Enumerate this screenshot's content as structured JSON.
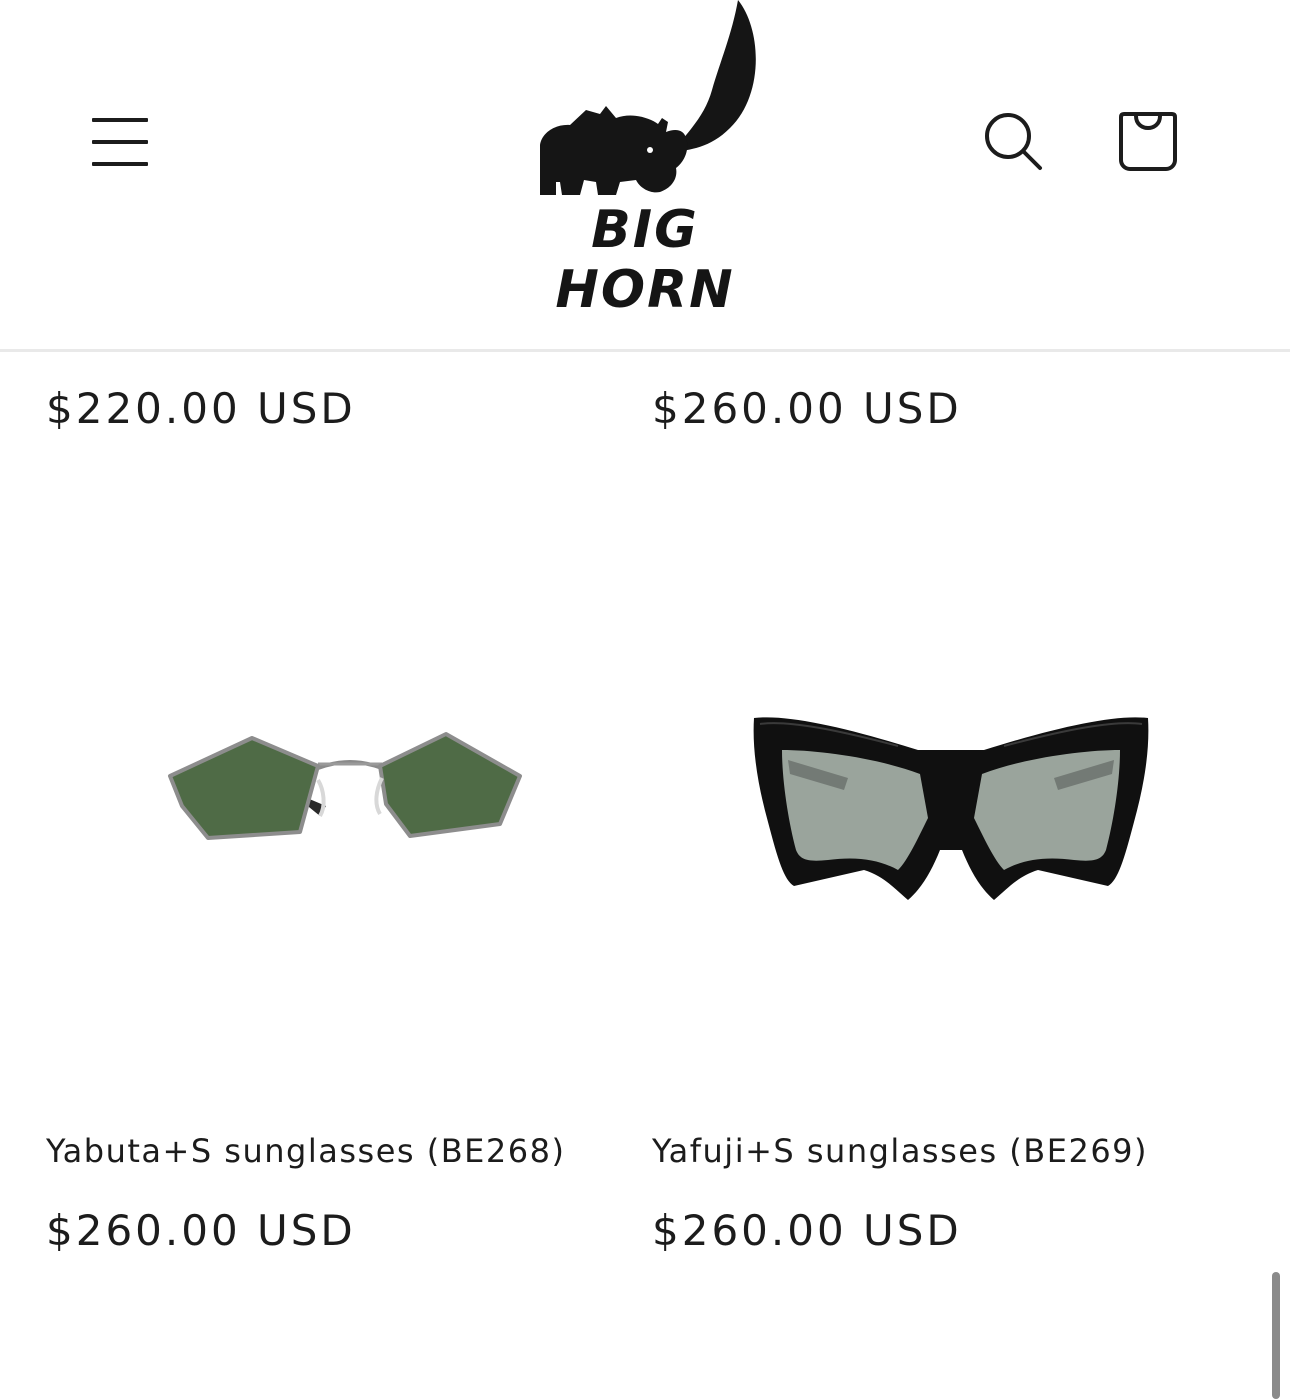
{
  "header": {
    "brand": "BIG HORN",
    "menu_icon": "hamburger-menu-icon",
    "search_icon": "search-icon",
    "cart_icon": "cart-bag-icon"
  },
  "products": [
    {
      "price": "$220.00 USD"
    },
    {
      "price": "$260.00 USD"
    },
    {
      "title": "Yabuta+S sunglasses (BE268)",
      "price": "$260.00 USD"
    },
    {
      "title": "Yafuji+S sunglasses (BE269)",
      "price": "$260.00 USD"
    }
  ],
  "colors": {
    "text": "#1c1c1c",
    "divider": "#e9e9e9",
    "lens_green": "#4f6b46",
    "lens_grey": "#9aa49c"
  }
}
